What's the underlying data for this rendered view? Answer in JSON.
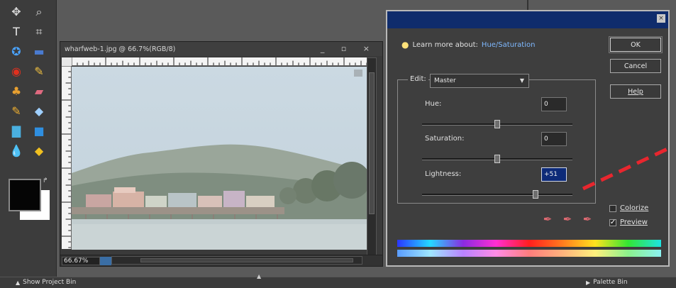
{
  "toolbox": {
    "tools": [
      {
        "name": "move-tool-icon",
        "glyph": "✥",
        "color": "#d8d8d8"
      },
      {
        "name": "zoom-tool-icon",
        "glyph": "⌕",
        "color": "#d8d8d8"
      },
      {
        "name": "type-tool-icon",
        "glyph": "T",
        "color": "#e8e8e8"
      },
      {
        "name": "crop-tool-icon",
        "glyph": "⌗",
        "color": "#e8e8e8"
      },
      {
        "name": "cookie-cutter-tool-icon",
        "glyph": "✪",
        "color": "#4aa3ff"
      },
      {
        "name": "straighten-tool-icon",
        "glyph": "▬",
        "color": "#4a7bd0"
      },
      {
        "name": "red-eye-tool-icon",
        "glyph": "◉",
        "color": "#e0301e"
      },
      {
        "name": "healing-brush-tool-icon",
        "glyph": "✎",
        "color": "#f0c040"
      },
      {
        "name": "clone-stamp-tool-icon",
        "glyph": "♣",
        "color": "#e8a030"
      },
      {
        "name": "eraser-tool-icon",
        "glyph": "▰",
        "color": "#e06a80"
      },
      {
        "name": "brush-tool-icon",
        "glyph": "✎",
        "color": "#f0b030"
      },
      {
        "name": "paint-bucket-tool-icon",
        "glyph": "◆",
        "color": "#9fd0ff"
      },
      {
        "name": "gradient-tool-icon",
        "glyph": "▇",
        "color": "#4ab0e0"
      },
      {
        "name": "shape-tool-icon",
        "glyph": "■",
        "color": "#2f8fe0"
      },
      {
        "name": "blur-tool-icon",
        "glyph": "💧",
        "color": "#3a8ce0"
      },
      {
        "name": "sponge-tool-icon",
        "glyph": "◆",
        "color": "#f0c020"
      }
    ]
  },
  "document": {
    "title": "wharfweb-1.jpg @ 66.7%(RGB/8)",
    "controls": "_ ▫ ×",
    "zoom": "66.67%"
  },
  "dialog": {
    "learn_prefix": "Learn more about:",
    "learn_link": "Hue/Saturation",
    "buttons": {
      "ok": "OK",
      "cancel": "Cancel",
      "help": "Help"
    },
    "edit_label": "Edit:",
    "edit_value": "Master",
    "sliders": [
      {
        "label": "Hue:",
        "value": "0",
        "fraction": 0.5,
        "active": false
      },
      {
        "label": "Saturation:",
        "value": "0",
        "fraction": 0.5,
        "active": false
      },
      {
        "label": "Lightness:",
        "value": "+51",
        "fraction": 0.755,
        "active": true
      }
    ],
    "colorize_label": "Colorize",
    "colorize_checked": false,
    "preview_label": "Preview",
    "preview_checked": true
  },
  "bottombar": {
    "show_project_bin": "Show Project Bin",
    "palette_bin": "Palette Bin"
  },
  "annotation_color": "#e8262e"
}
